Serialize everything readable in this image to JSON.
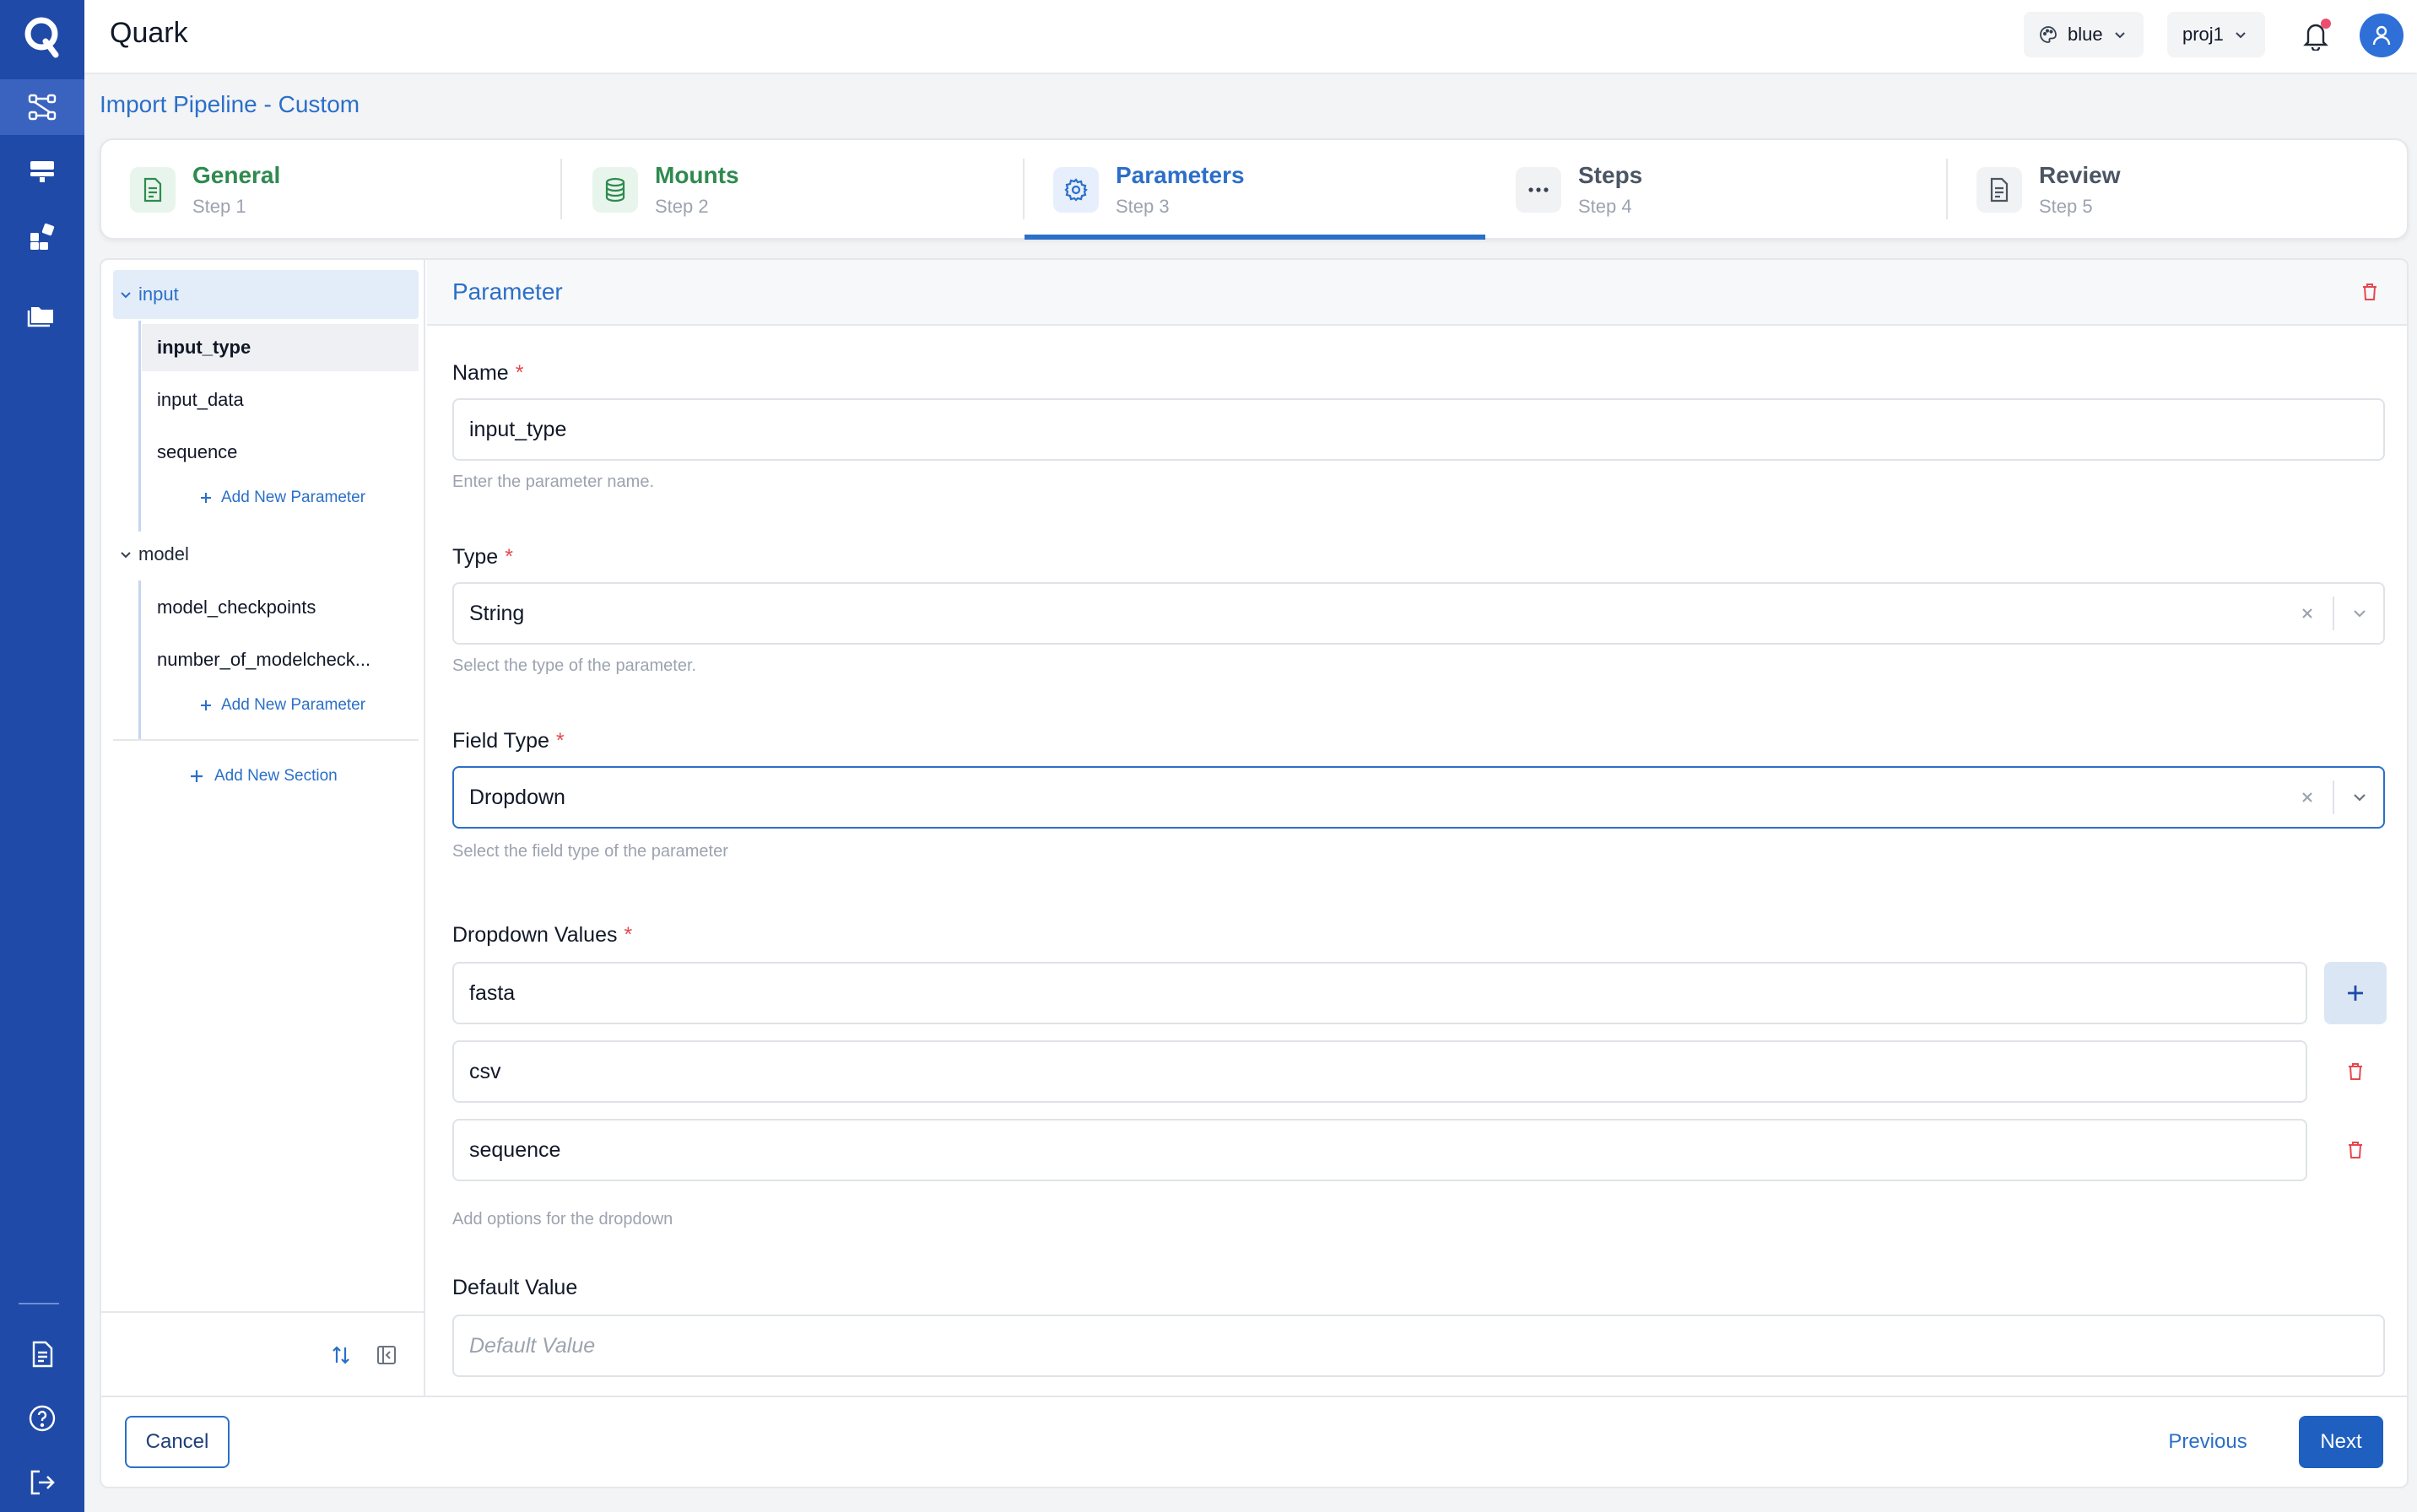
{
  "app": {
    "title": "Quark",
    "logo_letter": "Q"
  },
  "rail": {
    "top_items": [
      "pipelines-icon",
      "servers-icon",
      "apps-icon",
      "folder-icon"
    ],
    "active_item": "pipelines-icon",
    "bottom_items": [
      "document-icon",
      "help-icon",
      "logout-icon"
    ]
  },
  "header": {
    "theme_label": "blue",
    "project_label": "proj1",
    "notifications_unread": true
  },
  "page": {
    "title": "Import Pipeline - Custom"
  },
  "stepper": [
    {
      "name": "General",
      "step": "Step 1",
      "state": "done",
      "icon": "document-icon"
    },
    {
      "name": "Mounts",
      "step": "Step 2",
      "state": "done",
      "icon": "database-icon"
    },
    {
      "name": "Parameters",
      "step": "Step 3",
      "state": "active",
      "icon": "gear-icon"
    },
    {
      "name": "Steps",
      "step": "Step 4",
      "state": "todo",
      "icon": "ellipsis-icon"
    },
    {
      "name": "Review",
      "step": "Step 5",
      "state": "todo",
      "icon": "document-icon"
    }
  ],
  "tree": {
    "sections": [
      {
        "name": "input",
        "items": [
          "input_type",
          "input_data",
          "sequence"
        ],
        "selected": "input_type"
      },
      {
        "name": "model",
        "items": [
          "model_checkpoints",
          "number_of_modelcheck..."
        ]
      }
    ],
    "add_parameter_label": "Add New Parameter",
    "add_section_label": "Add New Section"
  },
  "form": {
    "header_title": "Parameter",
    "name": {
      "label": "Name",
      "required_mark": "*",
      "value": "input_type",
      "help": "Enter the parameter name."
    },
    "type": {
      "label": "Type",
      "required_mark": "*",
      "value": "String",
      "help": "Select the type of the parameter."
    },
    "field_type": {
      "label": "Field Type",
      "required_mark": "*",
      "value": "Dropdown",
      "help": "Select the field type of the parameter"
    },
    "dropdown_values": {
      "label": "Dropdown Values",
      "required_mark": "*",
      "values": [
        "fasta",
        "csv",
        "sequence"
      ],
      "help": "Add options for the dropdown"
    },
    "default_value": {
      "label": "Default Value",
      "placeholder": "Default Value"
    }
  },
  "footer": {
    "cancel_label": "Cancel",
    "previous_label": "Previous",
    "next_label": "Next"
  },
  "colors": {
    "rail": "#1f4aa8",
    "accent": "#2b6fc8",
    "done_green": "#2f8a4f",
    "danger": "#e5484d"
  }
}
